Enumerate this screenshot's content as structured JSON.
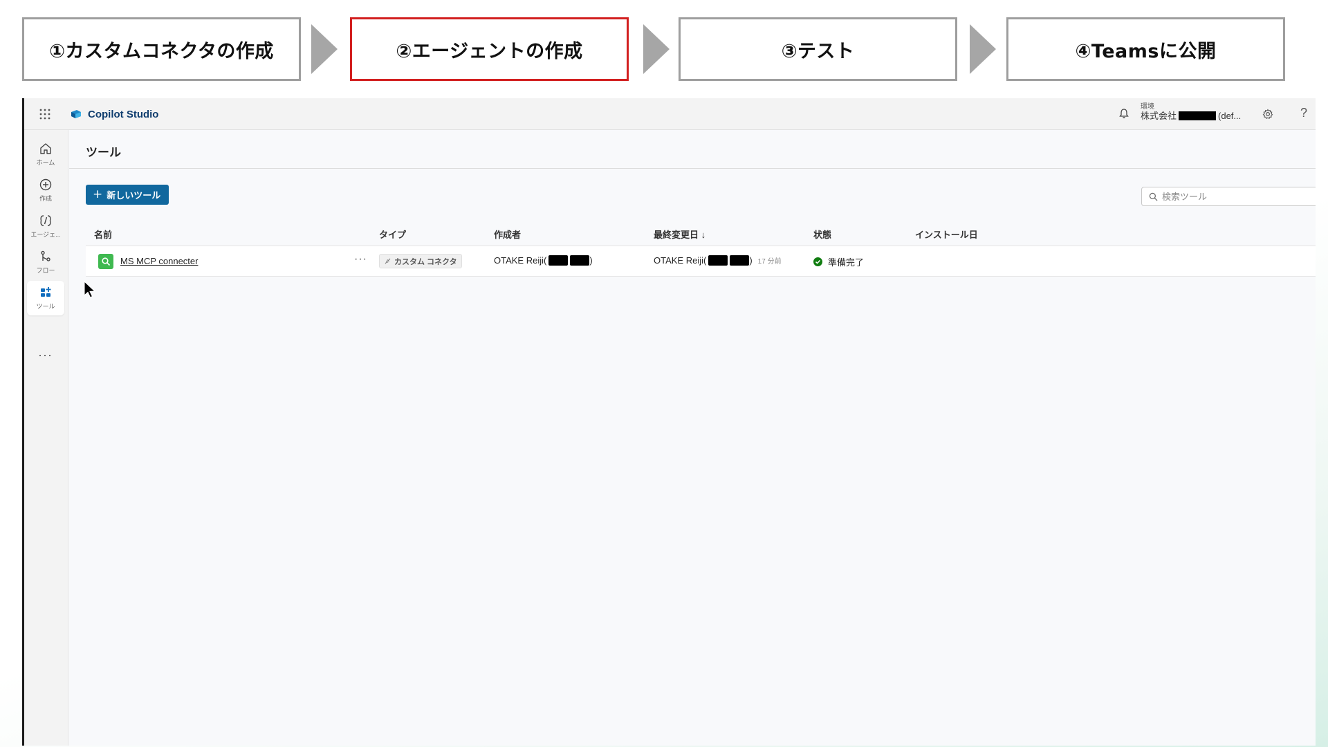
{
  "steps": [
    {
      "label": "①カスタムコネクタの作成",
      "active": false
    },
    {
      "label": "②エージェントの作成",
      "active": true
    },
    {
      "label": "③テスト",
      "active": false
    },
    {
      "label": "④Teamsに公開",
      "active": false
    }
  ],
  "app": {
    "brand": "Copilot Studio",
    "environment": {
      "label": "環境",
      "name_prefix": "株式会社",
      "name_suffix": "(def..."
    }
  },
  "siderail": {
    "items": [
      {
        "label": "ホーム",
        "icon": "home-icon"
      },
      {
        "label": "作成",
        "icon": "create-icon"
      },
      {
        "label": "エージェ...",
        "icon": "agents-icon"
      },
      {
        "label": "フロー",
        "icon": "flow-icon"
      },
      {
        "label": "ツール",
        "icon": "tools-icon",
        "active": true
      }
    ],
    "more": "···"
  },
  "page": {
    "title": "ツール",
    "new_button": "新しいツール",
    "search_placeholder": "検索ツール"
  },
  "table": {
    "columns": [
      "名前",
      "タイプ",
      "作成者",
      "最終変更日 ↓",
      "状態",
      "インストール日"
    ],
    "rows": [
      {
        "name": "MS MCP connecter",
        "more": "···",
        "type": "カスタム コネクタ",
        "creator": "OTAKE Reiji(",
        "creator_end": ")",
        "modified_by": "OTAKE Reiji(",
        "modified_end": ")",
        "modified_time": "17 分前",
        "status": "準備完了",
        "installed": ""
      }
    ]
  },
  "colors": {
    "accent": "#11689e",
    "active_step_border": "#d21f1f",
    "step_border": "#9e9e9e",
    "status_ready": "#107c10",
    "tool_icon": "#3fb950"
  }
}
